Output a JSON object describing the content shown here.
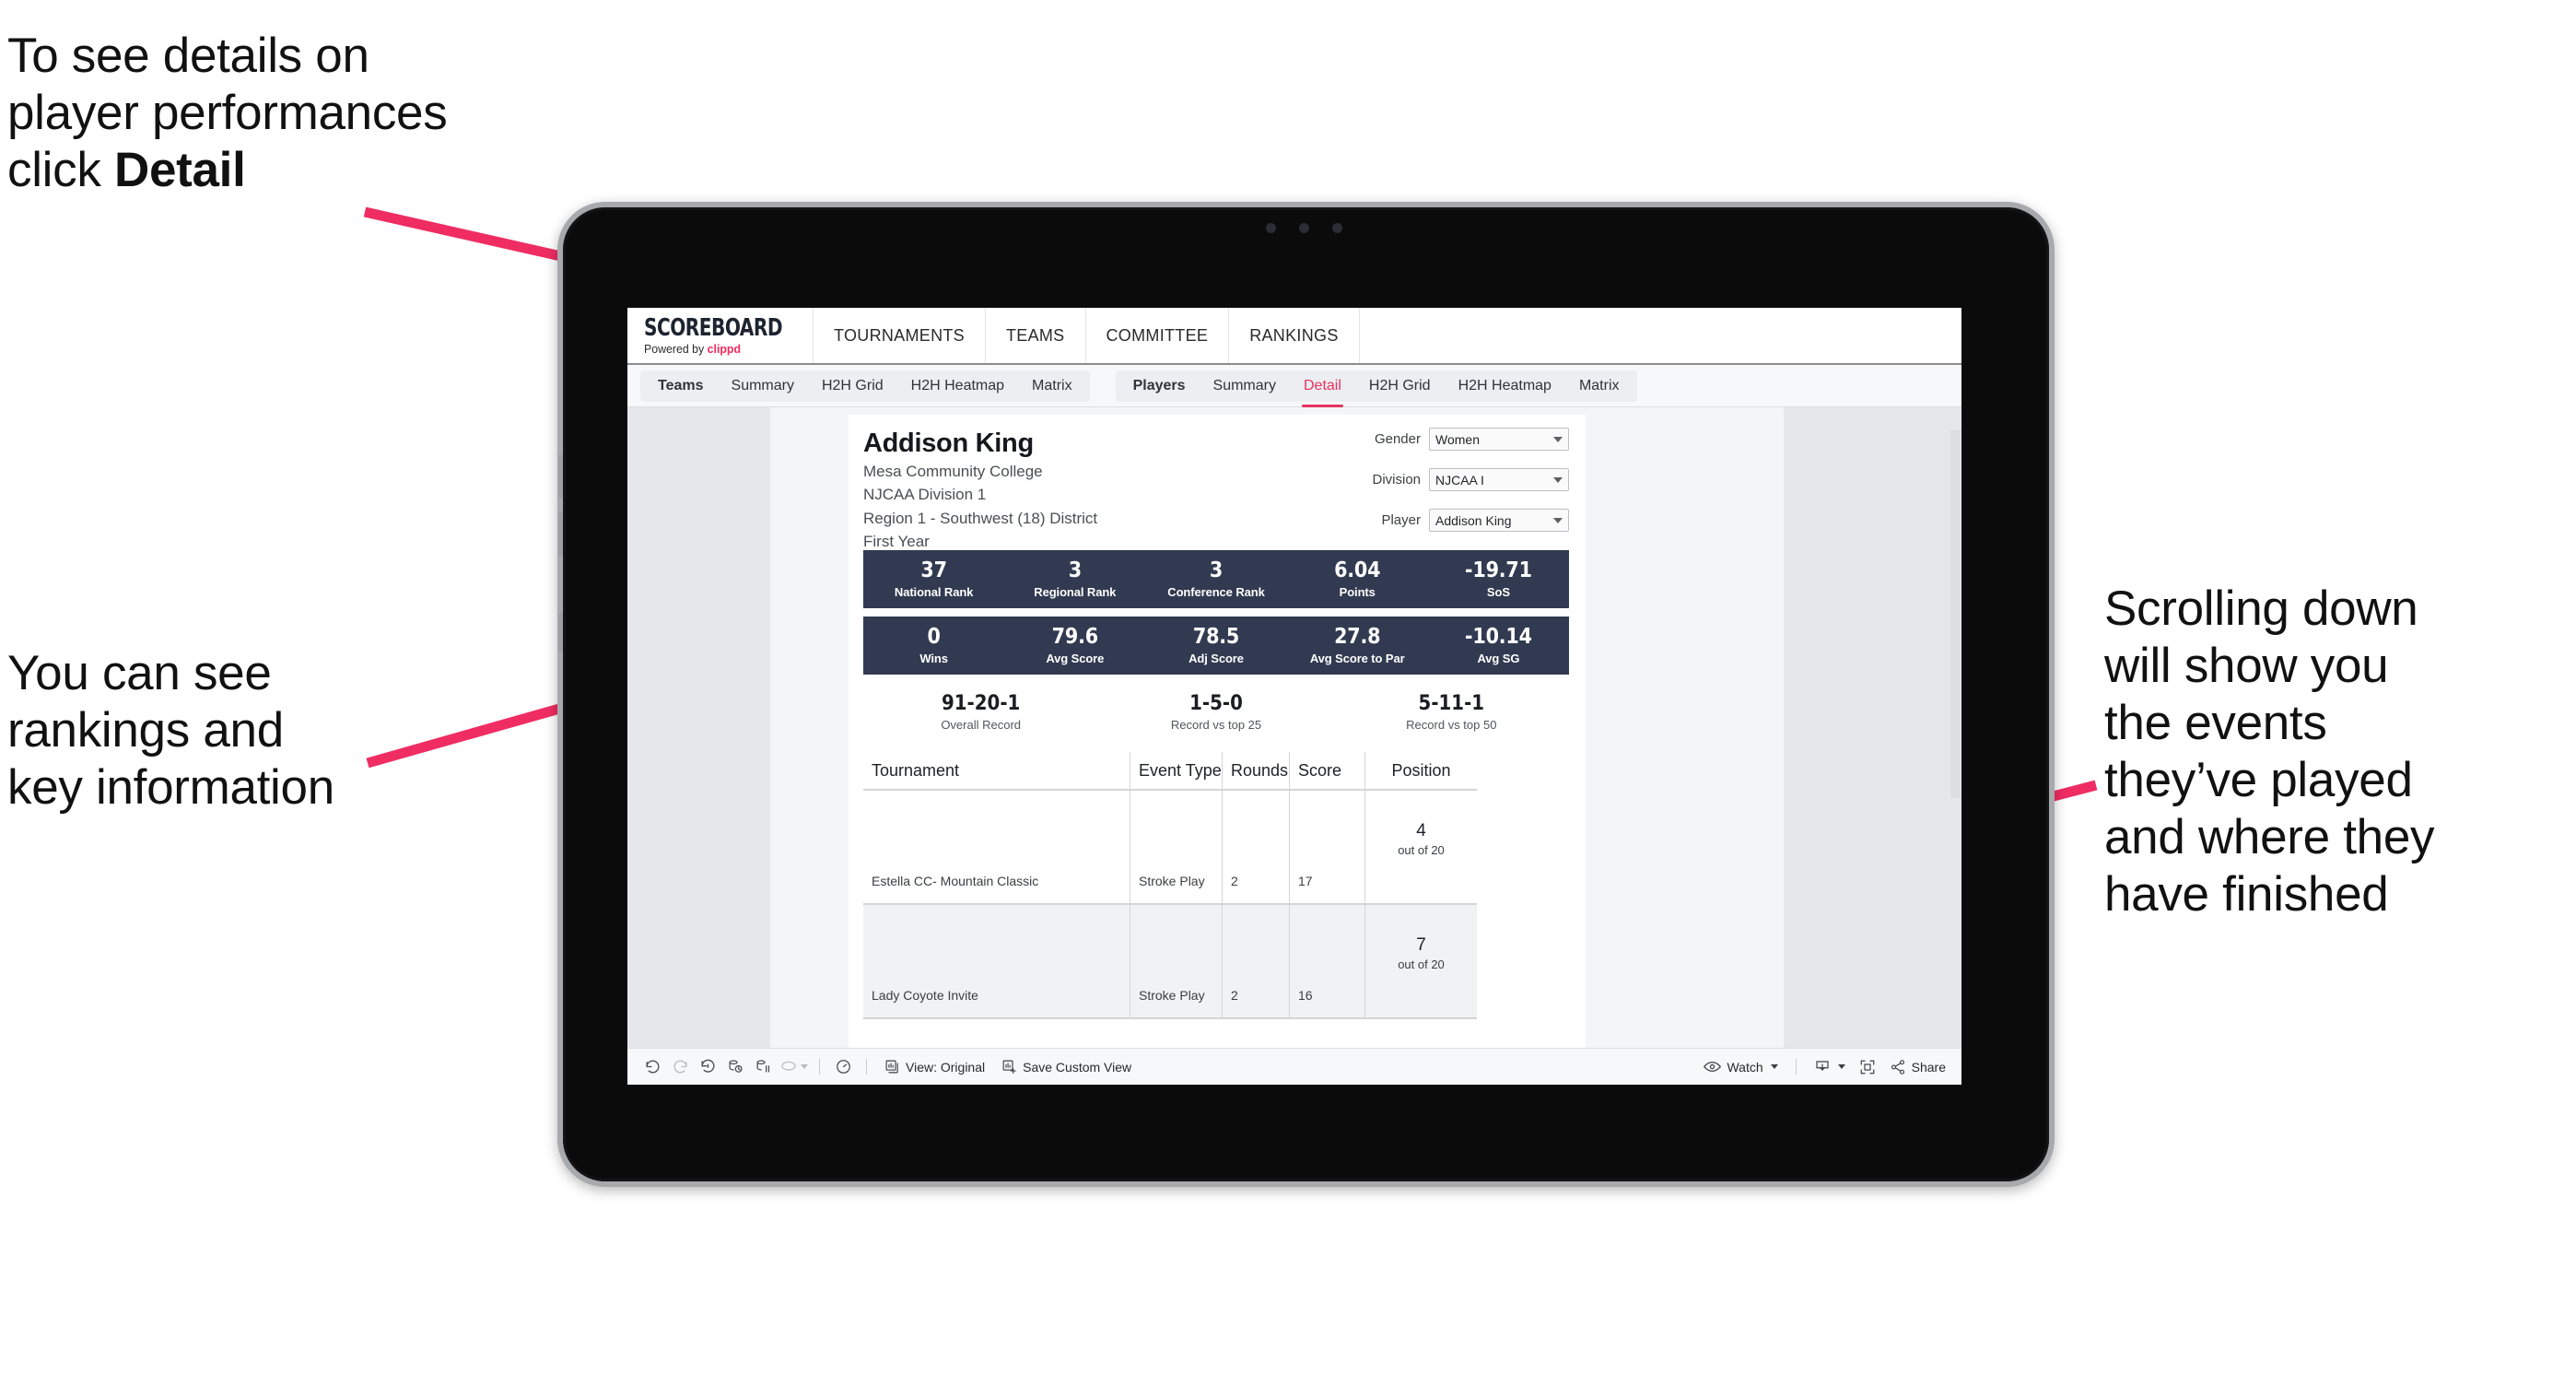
{
  "annotations": {
    "top_left": "To see details on\nplayer performances\nclick ",
    "top_left_bold": "Detail",
    "mid_left": "You can see\nrankings and\nkey information",
    "right": "Scrolling down\nwill show you\nthe events\nthey’ve played\nand where they\nhave finished"
  },
  "colors": {
    "accent_pink": "#e4335f",
    "arrow_pink": "#ef2d63",
    "stat_navy": "#313a50",
    "brand_red": "#f2295b"
  },
  "app": {
    "brand": {
      "title": "SCOREBOARD",
      "powered_prefix": "Powered by ",
      "powered_name": "clippd"
    },
    "top_nav": [
      "TOURNAMENTS",
      "TEAMS",
      "COMMITTEE",
      "RANKINGS"
    ],
    "sub_nav": {
      "group_teams": [
        "Teams",
        "Summary",
        "H2H Grid",
        "H2H Heatmap",
        "Matrix"
      ],
      "group_players": [
        "Players",
        "Summary",
        "Detail",
        "H2H Grid",
        "H2H Heatmap",
        "Matrix"
      ],
      "active_tab": "Detail"
    }
  },
  "player": {
    "name": "Addison King",
    "school": "Mesa Community College",
    "division": "NJCAA Division 1",
    "region": "Region 1 - Southwest (18) District",
    "year": "First Year"
  },
  "filters": [
    {
      "label": "Gender",
      "value": "Women"
    },
    {
      "label": "Division",
      "value": "NJCAA I"
    },
    {
      "label": "Player",
      "value": "Addison King"
    }
  ],
  "stats_row_1": [
    {
      "value": "37",
      "label": "National Rank"
    },
    {
      "value": "3",
      "label": "Regional Rank"
    },
    {
      "value": "3",
      "label": "Conference Rank"
    },
    {
      "value": "6.04",
      "label": "Points"
    },
    {
      "value": "-19.71",
      "label": "SoS"
    }
  ],
  "stats_row_2": [
    {
      "value": "0",
      "label": "Wins"
    },
    {
      "value": "79.6",
      "label": "Avg Score"
    },
    {
      "value": "78.5",
      "label": "Adj Score"
    },
    {
      "value": "27.8",
      "label": "Avg Score to Par"
    },
    {
      "value": "-10.14",
      "label": "Avg SG"
    }
  ],
  "records": [
    {
      "value": "91-20-1",
      "label": "Overall Record"
    },
    {
      "value": "1-5-0",
      "label": "Record vs top 25"
    },
    {
      "value": "5-11-1",
      "label": "Record vs top 50"
    }
  ],
  "table": {
    "headers": [
      "Tournament",
      "Event Type",
      "Rounds",
      "Score",
      "Position"
    ],
    "rows": [
      {
        "tournament": "Estella CC- Mountain Classic",
        "event_type": "Stroke Play",
        "rounds": "2",
        "score": "17",
        "position_num": "4",
        "position_sub": "out of 20"
      },
      {
        "tournament": "Lady Coyote Invite",
        "event_type": "Stroke Play",
        "rounds": "2",
        "score": "16",
        "position_num": "7",
        "position_sub": "out of 20"
      }
    ]
  },
  "toolbar": {
    "icons": [
      "undo-icon",
      "redo-icon",
      "revert-icon",
      "refresh-data-icon",
      "pause-auto-update-icon",
      "lasso-icon"
    ],
    "alerts_label": "alerts-icon",
    "view_original": "View: Original",
    "save_custom_view": "Save Custom View",
    "watch": "Watch",
    "share": "Share"
  }
}
